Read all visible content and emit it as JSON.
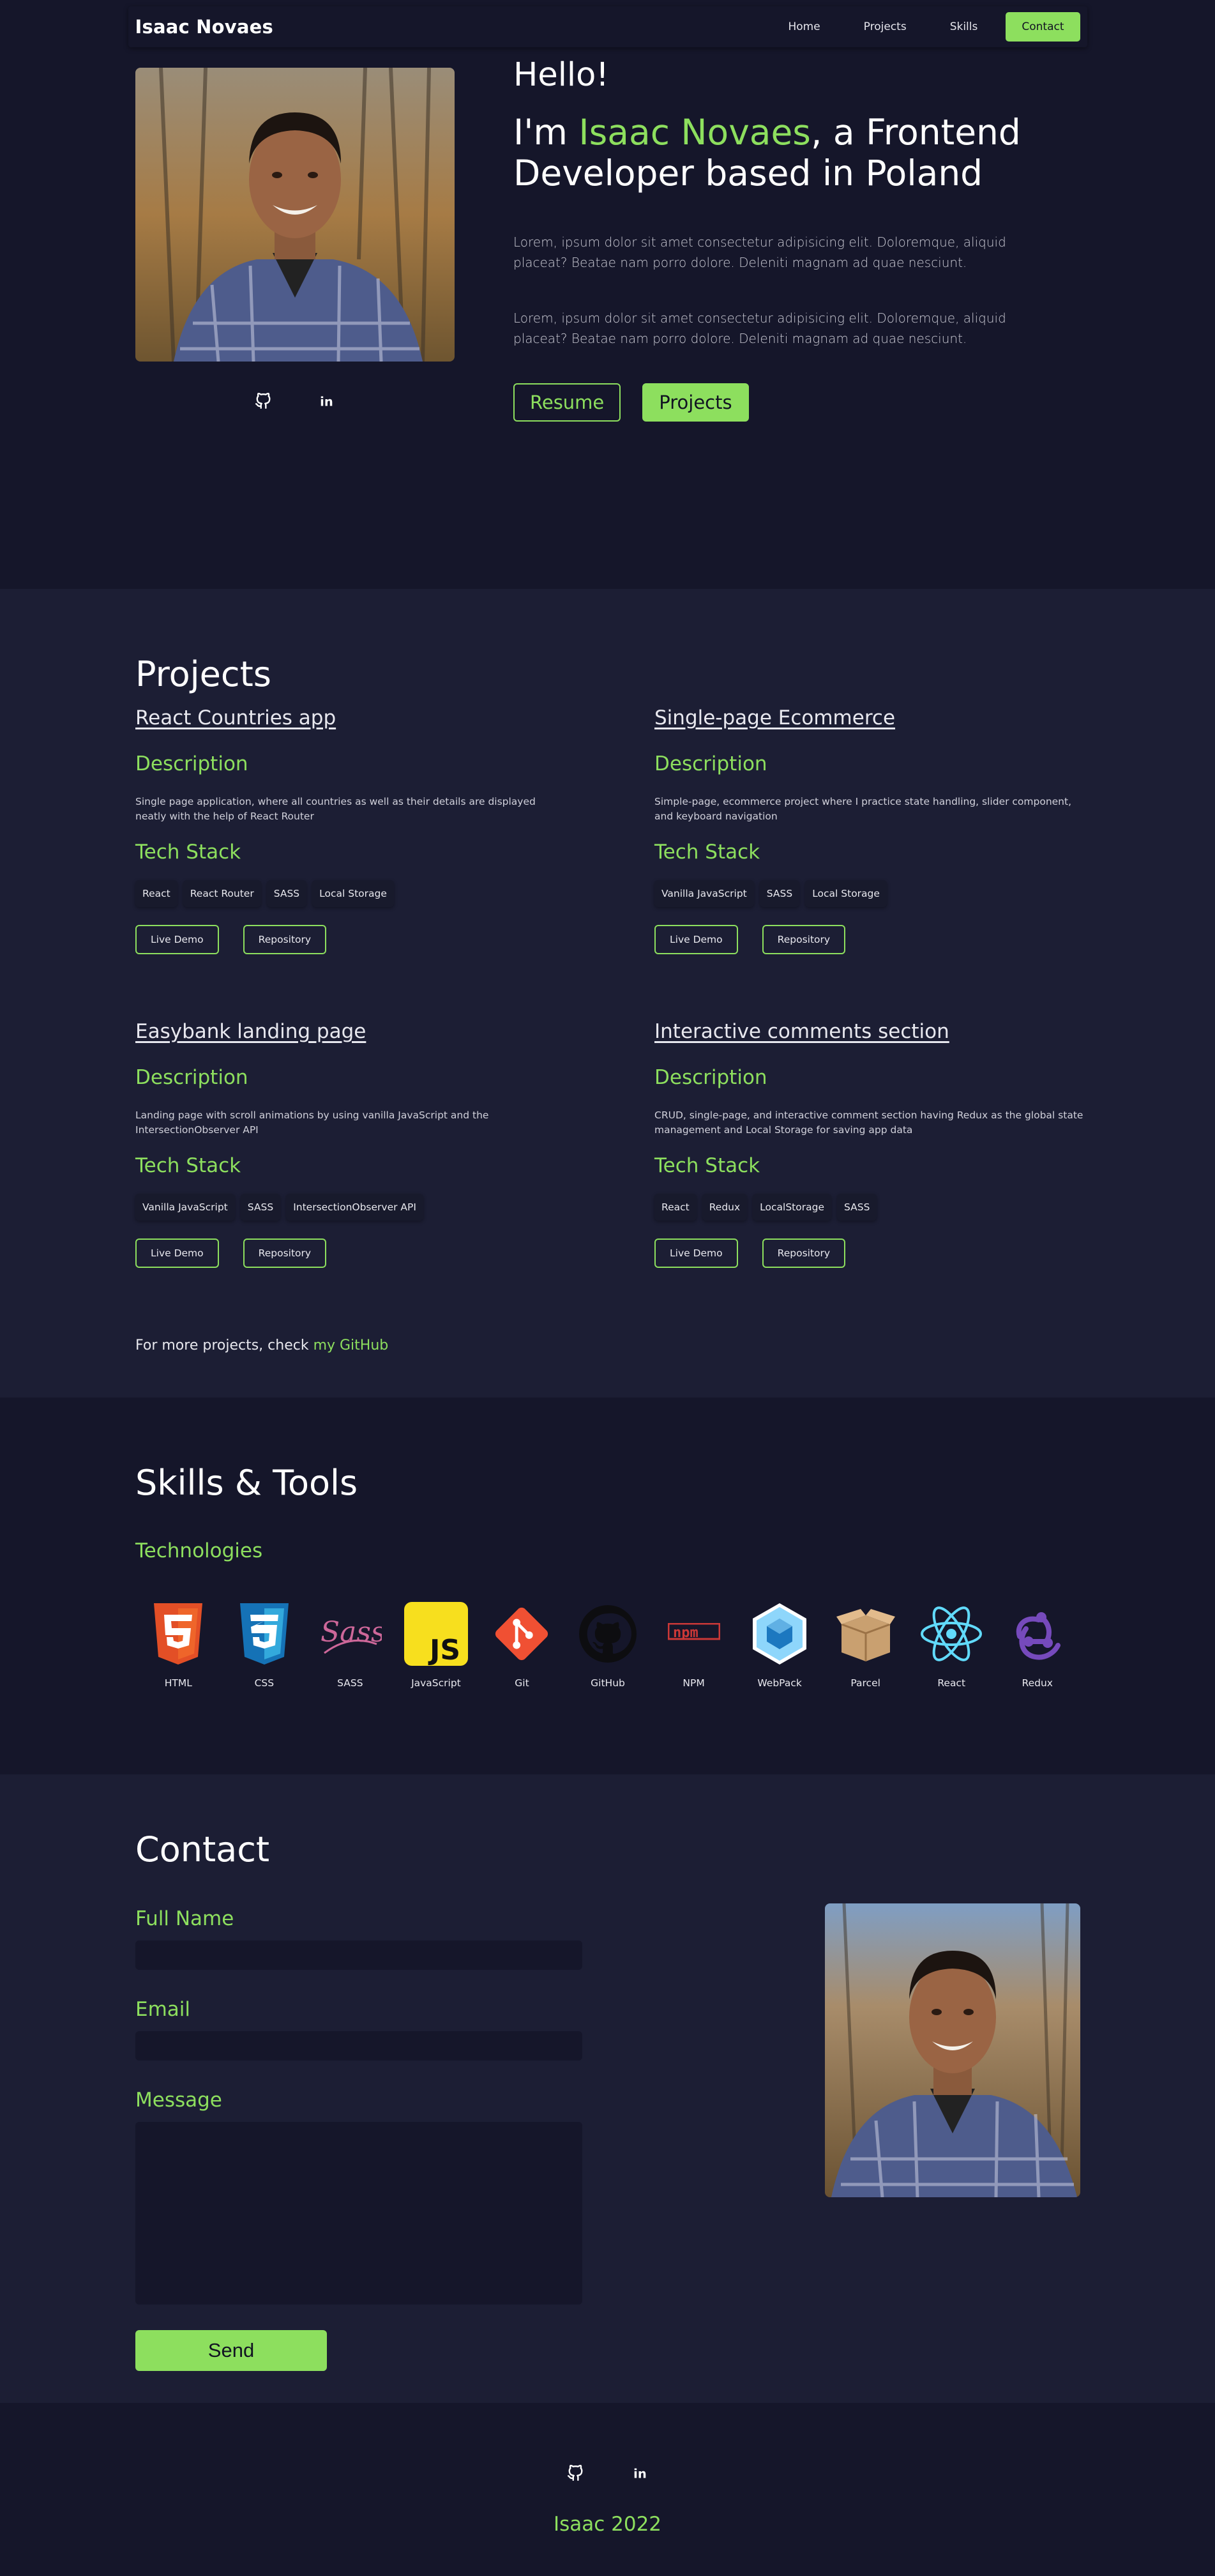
{
  "header": {
    "brand": "Isaac Novaes",
    "nav": [
      "Home",
      "Projects",
      "Skills"
    ],
    "contact_label": "Contact"
  },
  "hero": {
    "hello": "Hello!",
    "intro_prefix": "I'm ",
    "intro_name": "Isaac Novaes",
    "intro_suffix": ", a Frontend Developer based in Poland",
    "paragraph1": "Lorem, ipsum dolor sit amet consectetur adipisicing elit. Doloremque, aliquid placeat? Beatae nam porro dolore. Deleniti magnam ad quae nesciunt.",
    "paragraph2": "Lorem, ipsum dolor sit amet consectetur adipisicing elit. Doloremque, aliquid placeat? Beatae nam porro dolore. Deleniti magnam ad quae nesciunt.",
    "resume_label": "Resume",
    "projects_label": "Projects",
    "social_icons": [
      "github-icon",
      "linkedin-icon"
    ]
  },
  "projects": {
    "title": "Projects",
    "description_heading": "Description",
    "tech_heading": "Tech Stack",
    "live_demo_label": "Live Demo",
    "repository_label": "Repository",
    "items": [
      {
        "name": "React Countries app",
        "description": "Single page application, where all countries as well as their details are displayed neatly with the help of React Router",
        "tags": [
          "React",
          "React Router",
          "SASS",
          "Local Storage"
        ]
      },
      {
        "name": "Single-page Ecommerce",
        "description": "Simple-page, ecommerce project where I practice state handling, slider component, and keyboard navigation",
        "tags": [
          "Vanilla JavaScript",
          "SASS",
          "Local Storage"
        ]
      },
      {
        "name": "Easybank landing page",
        "description": "Landing page with scroll animations by using vanilla JavaScript and the IntersectionObserver API",
        "tags": [
          "Vanilla JavaScript",
          "SASS",
          "IntersectionObserver API"
        ]
      },
      {
        "name": "Interactive comments section",
        "description": "CRUD, single-page, and interactive comment section having Redux as the global state management and Local Storage for saving app data",
        "tags": [
          "React",
          "Redux",
          "LocalStorage",
          "SASS"
        ]
      }
    ],
    "more_prefix": "For more projects, check ",
    "more_link": "my GitHub"
  },
  "skills": {
    "title": "Skills & Tools",
    "subtitle": "Technologies",
    "items": [
      {
        "name": "HTML",
        "icon": "html5-icon"
      },
      {
        "name": "CSS",
        "icon": "css3-icon"
      },
      {
        "name": "SASS",
        "icon": "sass-icon"
      },
      {
        "name": "JavaScript",
        "icon": "javascript-icon"
      },
      {
        "name": "Git",
        "icon": "git-icon"
      },
      {
        "name": "GitHub",
        "icon": "github-icon"
      },
      {
        "name": "NPM",
        "icon": "npm-icon"
      },
      {
        "name": "WebPack",
        "icon": "webpack-icon"
      },
      {
        "name": "Parcel",
        "icon": "parcel-icon"
      },
      {
        "name": "React",
        "icon": "react-icon"
      },
      {
        "name": "Redux",
        "icon": "redux-icon"
      }
    ]
  },
  "contact": {
    "title": "Contact",
    "full_name_label": "Full Name",
    "email_label": "Email",
    "message_label": "Message",
    "send_label": "Send"
  },
  "footer": {
    "credit": "Isaac 2022"
  },
  "colors": {
    "accent": "#8ddf5e",
    "background_dark": "#15162a",
    "background_alt": "#1c1e34"
  }
}
